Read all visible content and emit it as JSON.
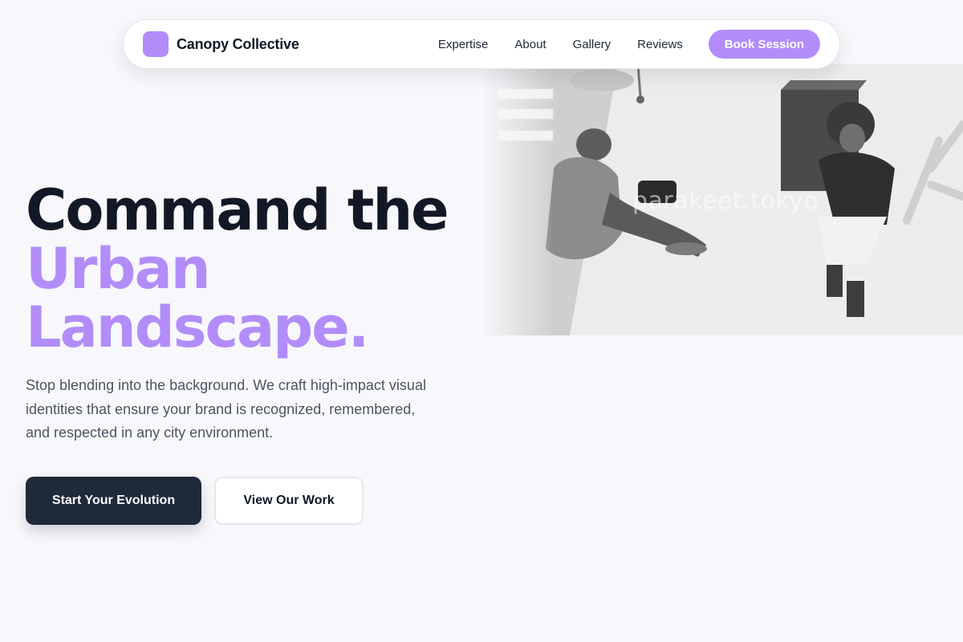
{
  "brand": {
    "name": "Canopy Collective",
    "accent_color": "#b28dfa"
  },
  "nav": {
    "links": [
      "Expertise",
      "About",
      "Gallery",
      "Reviews"
    ],
    "cta_label": "Book Session"
  },
  "hero": {
    "headline_line1": "Command the",
    "headline_line2": "Urban",
    "headline_line3": "Landscape.",
    "subtext": "Stop blending into the background. We craft high-impact visual identities that ensure your brand is recognized, remembered, and respected in any city environment.",
    "primary_button": "Start Your Evolution",
    "secondary_button": "View Our Work",
    "photo_watermark": "parakeet.tokyo"
  },
  "colors": {
    "background": "#f8f8fc",
    "dark": "#121826",
    "primary_button_bg": "#1e293b"
  }
}
